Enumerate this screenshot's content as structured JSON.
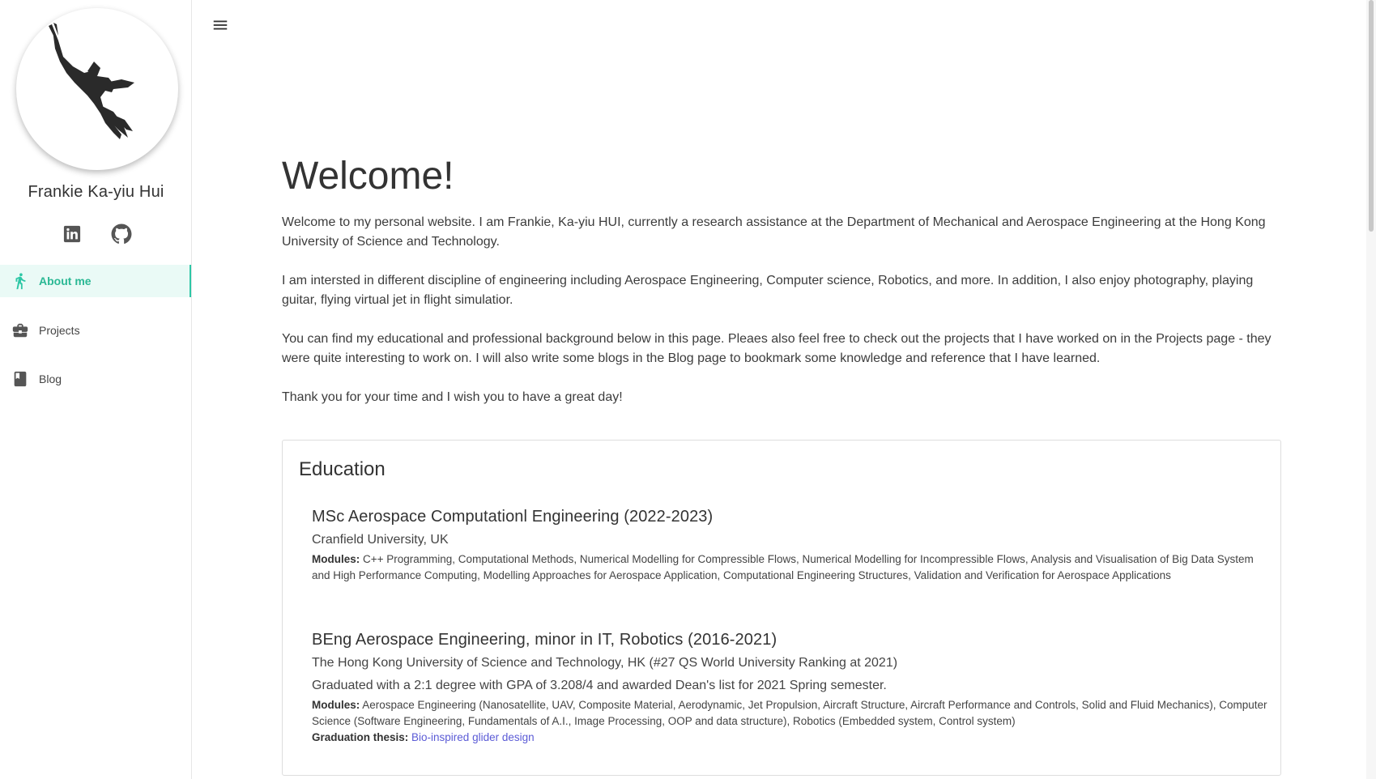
{
  "profile": {
    "name": "Frankie Ka-yiu Hui",
    "avatar_icon": "raven-photo"
  },
  "social": [
    {
      "name": "linkedin-icon"
    },
    {
      "name": "github-icon"
    }
  ],
  "nav": {
    "items": [
      {
        "label": "About me",
        "icon": "person-walking-icon",
        "active": true
      },
      {
        "label": "Projects",
        "icon": "briefcase-icon",
        "active": false
      },
      {
        "label": "Blog",
        "icon": "book-icon",
        "active": false
      }
    ]
  },
  "main": {
    "title": "Welcome!",
    "paragraphs": [
      "Welcome to my personal website. I am Frankie, Ka-yiu HUI, currently a research assistance at the Department of Mechanical and Aerospace Engineering at the Hong Kong University of Science and Technology.",
      "I am intersted in different discipline of engineering including Aerospace Engineering, Computer science, Robotics, and more. In addition, I also enjoy photography, playing guitar, flying virtual jet in flight simulatior.",
      "You can find my educational and professional background below in this page. Pleaes also feel free to check out the projects that I have worked on in the Projects page - they were quite interesting to work on. I will also write some blogs in the Blog page to bookmark some knowledge and reference that I have learned.",
      "Thank you for your time and I wish you to have a great day!"
    ]
  },
  "education": {
    "title": "Education",
    "items": [
      {
        "degree": "MSc Aerospace Computationl Engineering (2022-2023)",
        "school": "Cranfield University, UK",
        "modules_label": "Modules:",
        "modules": "C++ Programming, Computational Methods, Numerical Modelling for Compressible Flows, Numerical Modelling for Incompressible Flows, Analysis and Visualisation of Big Data System and High Performance Computing, Modelling Approaches for Aerospace Application, Computational Engineering Structures, Validation and Verification for Aerospace Applications"
      },
      {
        "degree": "BEng Aerospace Engineering, minor in IT, Robotics (2016-2021)",
        "school": "The Hong Kong University of Science and Technology, HK (#27 QS World University Ranking at 2021)",
        "note": "Graduated with a 2:1 degree with GPA of 3.208/4 and awarded Dean's list for 2021 Spring semester.",
        "modules_label": "Modules:",
        "modules": "Aerospace Engineering (Nanosatellite, UAV, Composite Material, Aerodynamic, Jet Propulsion, Aircraft Structure, Aircraft Performance and Controls, Solid and Fluid Mechanics), Computer Science (Software Engineering, Fundamentals of A.I., Image Processing, OOP and data structure), Robotics (Embedded system, Control system)",
        "thesis_label": "Graduation thesis:",
        "thesis_link": "Bio-inspired glider design"
      }
    ]
  },
  "colors": {
    "accent": "#2ec7a6",
    "active_bg": "#eafaf6",
    "link": "#5b5bd6"
  }
}
